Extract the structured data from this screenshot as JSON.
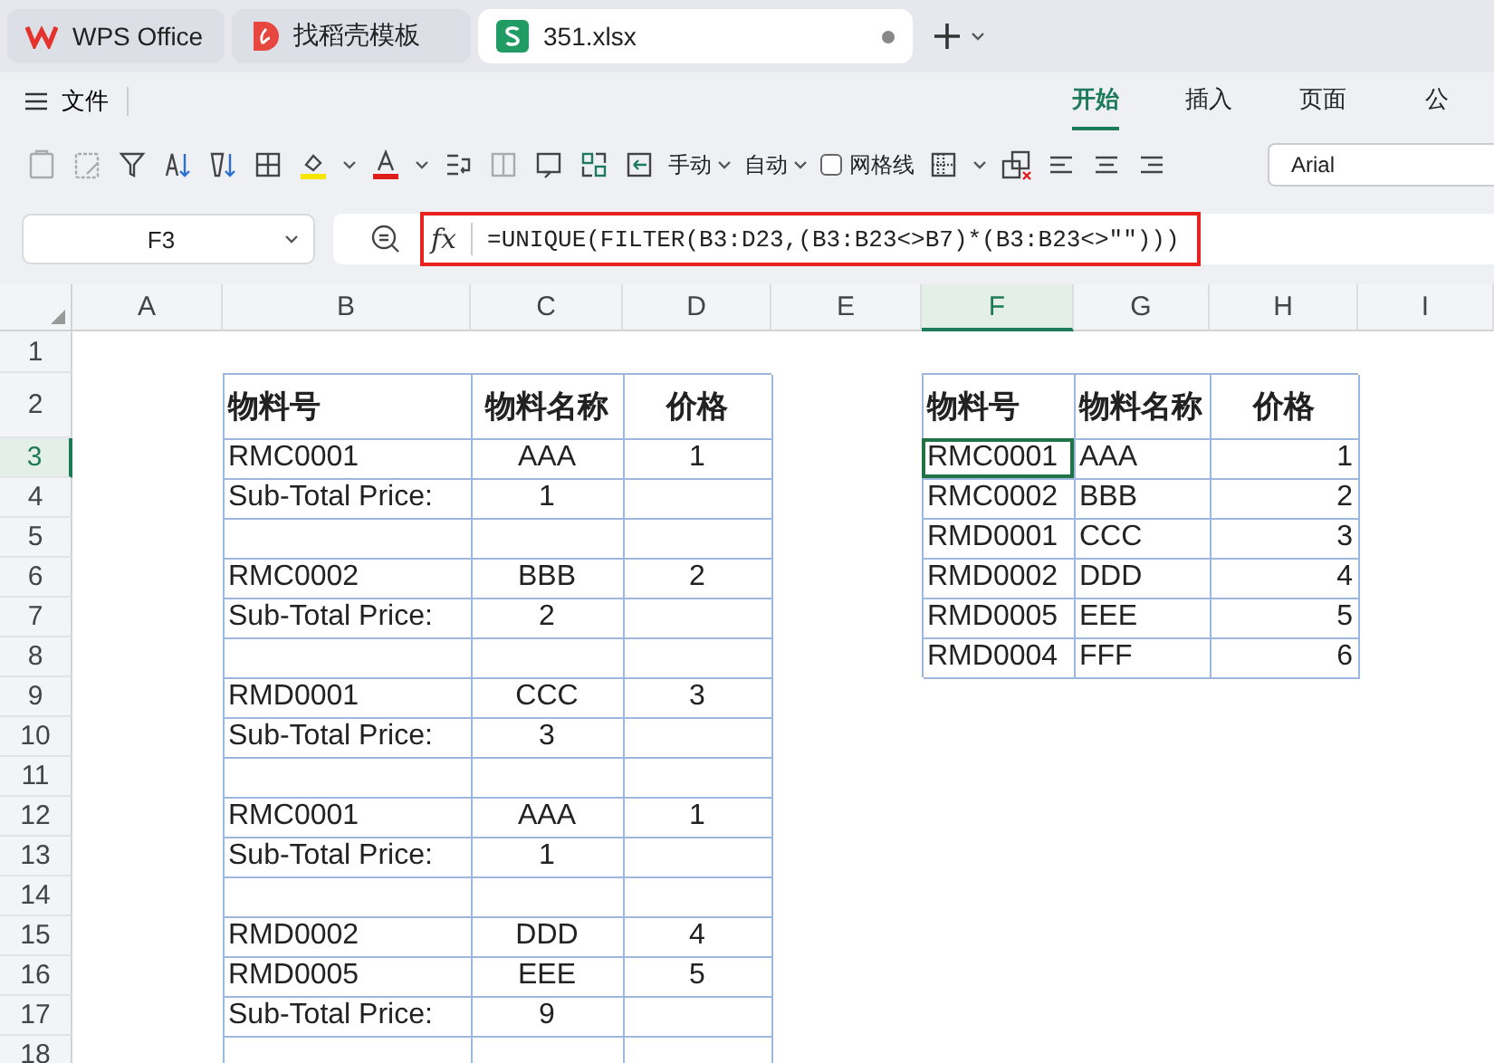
{
  "tabs": [
    {
      "label": "WPS Office",
      "kind": "wps",
      "selected": false
    },
    {
      "label": "找稻壳模板",
      "kind": "docer",
      "selected": false
    },
    {
      "label": "351.xlsx",
      "kind": "sheet",
      "selected": true
    }
  ],
  "menu": {
    "file": "文件",
    "ribbon_tabs": [
      {
        "label": "开始",
        "selected": true
      },
      {
        "label": "插入",
        "selected": false
      },
      {
        "label": "页面",
        "selected": false
      },
      {
        "label": "公",
        "selected": false
      }
    ]
  },
  "toolbar": {
    "wrap_modes": [
      "手动",
      "自动"
    ],
    "gridlines": {
      "label": "网格线",
      "checked": false
    },
    "font": "Arial"
  },
  "formula_bar": {
    "name_box": "F3",
    "fx": "fx",
    "formula": "=UNIQUE(FILTER(B3:D23,(B3:B23<>B7)*(B3:B23<>\"\")))"
  },
  "columns": [
    {
      "label": "A",
      "selected": false
    },
    {
      "label": "B",
      "selected": false
    },
    {
      "label": "C",
      "selected": false
    },
    {
      "label": "D",
      "selected": false
    },
    {
      "label": "E",
      "selected": false
    },
    {
      "label": "F",
      "selected": true
    },
    {
      "label": "G",
      "selected": false
    },
    {
      "label": "H",
      "selected": false
    },
    {
      "label": "I",
      "selected": false
    }
  ],
  "rows": [
    {
      "number": "1",
      "selected": false,
      "cells": [
        null,
        null,
        null,
        null,
        null,
        null,
        null,
        null,
        null
      ]
    },
    {
      "number": "2",
      "selected": false,
      "cells": [
        null,
        {
          "kind": "heading",
          "text": "物料号",
          "selected": false
        },
        {
          "kind": "title",
          "text": "物料名称",
          "selected": false
        },
        {
          "kind": "title",
          "text": "价格",
          "selected": false
        },
        null,
        {
          "kind": "heading",
          "text": "物料号",
          "selected": false
        },
        {
          "kind": "heading",
          "text": "物料名称",
          "selected": false
        },
        {
          "kind": "title",
          "text": "价格",
          "selected": false
        },
        null
      ]
    },
    {
      "number": "3",
      "selected": true,
      "cells": [
        null,
        {
          "kind": "text",
          "text": "RMC0001",
          "selected": false
        },
        {
          "kind": "centered",
          "text": "AAA",
          "selected": false
        },
        {
          "kind": "centered",
          "text": "1",
          "selected": false
        },
        null,
        {
          "kind": "text",
          "text": "RMC0001",
          "selected": true
        },
        {
          "kind": "text",
          "text": "AAA",
          "selected": false
        },
        {
          "kind": "number",
          "text": "1",
          "selected": false
        },
        null
      ]
    },
    {
      "number": "4",
      "selected": false,
      "cells": [
        null,
        {
          "kind": "text",
          "text": "Sub-Total Price:",
          "selected": false
        },
        {
          "kind": "centered",
          "text": "1",
          "selected": false
        },
        {
          "kind": "blank",
          "selected": false
        },
        null,
        {
          "kind": "text",
          "text": "RMC0002",
          "selected": false
        },
        {
          "kind": "text",
          "text": "BBB",
          "selected": false
        },
        {
          "kind": "number",
          "text": "2",
          "selected": false
        },
        null
      ]
    },
    {
      "number": "5",
      "selected": false,
      "cells": [
        null,
        {
          "kind": "blank",
          "selected": false
        },
        {
          "kind": "blank",
          "selected": false
        },
        {
          "kind": "blank",
          "selected": false
        },
        null,
        {
          "kind": "text",
          "text": "RMD0001",
          "selected": false
        },
        {
          "kind": "text",
          "text": "CCC",
          "selected": false
        },
        {
          "kind": "number",
          "text": "3",
          "selected": false
        },
        null
      ]
    },
    {
      "number": "6",
      "selected": false,
      "cells": [
        null,
        {
          "kind": "text",
          "text": "RMC0002",
          "selected": false
        },
        {
          "kind": "centered",
          "text": "BBB",
          "selected": false
        },
        {
          "kind": "centered",
          "text": "2",
          "selected": false
        },
        null,
        {
          "kind": "text",
          "text": "RMD0002",
          "selected": false
        },
        {
          "kind": "text",
          "text": "DDD",
          "selected": false
        },
        {
          "kind": "number",
          "text": "4",
          "selected": false
        },
        null
      ]
    },
    {
      "number": "7",
      "selected": false,
      "cells": [
        null,
        {
          "kind": "text",
          "text": "Sub-Total Price:",
          "selected": false
        },
        {
          "kind": "centered",
          "text": "2",
          "selected": false
        },
        {
          "kind": "blank",
          "selected": false
        },
        null,
        {
          "kind": "text",
          "text": "RMD0005",
          "selected": false
        },
        {
          "kind": "text",
          "text": "EEE",
          "selected": false
        },
        {
          "kind": "number",
          "text": "5",
          "selected": false
        },
        null
      ]
    },
    {
      "number": "8",
      "selected": false,
      "cells": [
        null,
        {
          "kind": "blank",
          "selected": false
        },
        {
          "kind": "blank",
          "selected": false
        },
        {
          "kind": "blank",
          "selected": false
        },
        null,
        {
          "kind": "text",
          "text": "RMD0004",
          "selected": false
        },
        {
          "kind": "text",
          "text": "FFF",
          "selected": false
        },
        {
          "kind": "number",
          "text": "6",
          "selected": false
        },
        null
      ]
    },
    {
      "number": "9",
      "selected": false,
      "cells": [
        null,
        {
          "kind": "text",
          "text": "RMD0001",
          "selected": false
        },
        {
          "kind": "centered",
          "text": "CCC",
          "selected": false
        },
        {
          "kind": "centered",
          "text": "3",
          "selected": false
        },
        null,
        null,
        null,
        null,
        null
      ]
    },
    {
      "number": "10",
      "selected": false,
      "cells": [
        null,
        {
          "kind": "text",
          "text": "Sub-Total Price:",
          "selected": false
        },
        {
          "kind": "centered",
          "text": "3",
          "selected": false
        },
        {
          "kind": "blank",
          "selected": false
        },
        null,
        null,
        null,
        null,
        null
      ]
    },
    {
      "number": "11",
      "selected": false,
      "cells": [
        null,
        {
          "kind": "blank",
          "selected": false
        },
        {
          "kind": "blank",
          "selected": false
        },
        {
          "kind": "blank",
          "selected": false
        },
        null,
        null,
        null,
        null,
        null
      ]
    },
    {
      "number": "12",
      "selected": false,
      "cells": [
        null,
        {
          "kind": "text",
          "text": "RMC0001",
          "selected": false
        },
        {
          "kind": "centered",
          "text": "AAA",
          "selected": false
        },
        {
          "kind": "centered",
          "text": "1",
          "selected": false
        },
        null,
        null,
        null,
        null,
        null
      ]
    },
    {
      "number": "13",
      "selected": false,
      "cells": [
        null,
        {
          "kind": "text",
          "text": "Sub-Total Price:",
          "selected": false
        },
        {
          "kind": "centered",
          "text": "1",
          "selected": false
        },
        {
          "kind": "blank",
          "selected": false
        },
        null,
        null,
        null,
        null,
        null
      ]
    },
    {
      "number": "14",
      "selected": false,
      "cells": [
        null,
        {
          "kind": "blank",
          "selected": false
        },
        {
          "kind": "blank",
          "selected": false
        },
        {
          "kind": "blank",
          "selected": false
        },
        null,
        null,
        null,
        null,
        null
      ]
    },
    {
      "number": "15",
      "selected": false,
      "cells": [
        null,
        {
          "kind": "text",
          "text": "RMD0002",
          "selected": false
        },
        {
          "kind": "centered",
          "text": "DDD",
          "selected": false
        },
        {
          "kind": "centered",
          "text": "4",
          "selected": false
        },
        null,
        null,
        null,
        null,
        null
      ]
    },
    {
      "number": "16",
      "selected": false,
      "cells": [
        null,
        {
          "kind": "text",
          "text": "RMD0005",
          "selected": false
        },
        {
          "kind": "centered",
          "text": "EEE",
          "selected": false
        },
        {
          "kind": "centered",
          "text": "5",
          "selected": false
        },
        null,
        null,
        null,
        null,
        null
      ]
    },
    {
      "number": "17",
      "selected": false,
      "cells": [
        null,
        {
          "kind": "text",
          "text": "Sub-Total Price:",
          "selected": false
        },
        {
          "kind": "centered",
          "text": "9",
          "selected": false
        },
        {
          "kind": "blank",
          "selected": false
        },
        null,
        null,
        null,
        null,
        null
      ]
    },
    {
      "number": "18",
      "selected": false,
      "cells": [
        null,
        {
          "kind": "blank",
          "selected": false
        },
        {
          "kind": "blank",
          "selected": false
        },
        {
          "kind": "blank",
          "selected": false
        },
        null,
        null,
        null,
        null,
        null
      ]
    }
  ]
}
